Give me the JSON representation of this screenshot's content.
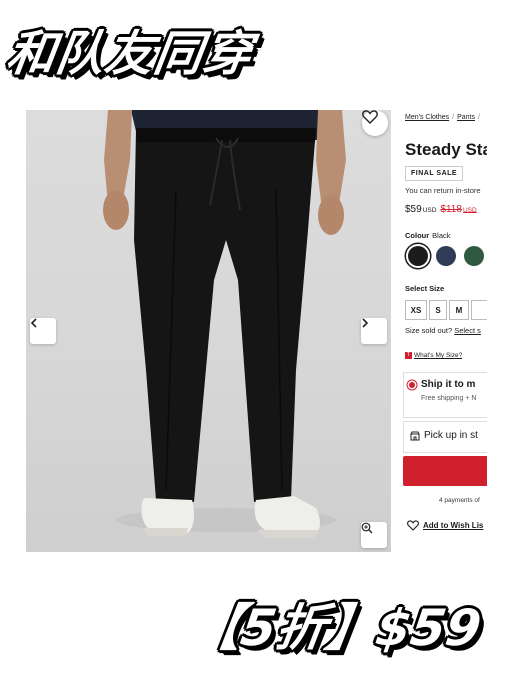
{
  "captions": {
    "top": "和队友同穿",
    "bottom": "【5折】$59"
  },
  "icons": {
    "wishlist_heart": "heart-outline-icon",
    "prev": "chevron-left-icon",
    "next": "chevron-right-icon",
    "zoom": "zoom-in-icon",
    "store": "store-icon",
    "wms_logo": "t-logo-icon"
  },
  "product": {
    "breadcrumb": [
      "Men's Clothes",
      "Pants"
    ],
    "title": "Steady Sta",
    "badge": "FINAL SALE",
    "return_note": "You can return in-store",
    "price": "$59",
    "currency": "USD",
    "old_price": "$118",
    "old_currency": "USD",
    "colour_label": "Colour",
    "colour_value": "Black",
    "swatches": [
      {
        "name": "Black",
        "color": "#1c1c1c",
        "selected": true
      },
      {
        "name": "Navy",
        "color": "#2f3c58",
        "selected": false
      },
      {
        "name": "Green",
        "color": "#2f5a40",
        "selected": false
      }
    ],
    "size_label": "Select Size",
    "sizes": [
      "XS",
      "S",
      "M",
      ""
    ],
    "soldout_text": "Size sold out?",
    "soldout_link": "Select s",
    "whats_my_size": "What's My Size?",
    "ship_title": "Ship it to m",
    "ship_sub": "Free shipping + N",
    "pickup": "Pick up in st",
    "payments": "4 payments of",
    "wishlist": "Add to Wish Lis"
  },
  "colors": {
    "accent_red": "#d0202e",
    "text_dark": "#1a1a1a"
  }
}
